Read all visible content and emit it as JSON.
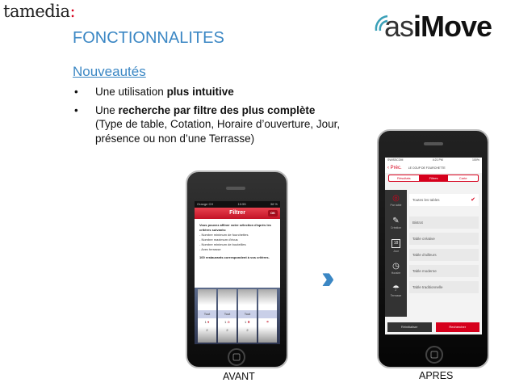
{
  "brand": {
    "tamedia": "tamedia",
    "colon": ":",
    "asimove_light": "as",
    "asimove_bold": "iMove"
  },
  "title": "FONCTIONNALITES",
  "subtitle": "Nouveautés",
  "bullets": [
    {
      "pre": "Une utilisation ",
      "bold": "plus intuitive",
      "post": ""
    },
    {
      "pre": "Une ",
      "bold": "recherche par filtre des plus complète",
      "post": " (Type de table, Cotation, Horaire d’ouverture, Jour, présence ou non d’une Terrasse)"
    }
  ],
  "before": {
    "caption": "AVANT",
    "status": {
      "carrier": "Orange CH",
      "time": "10:55",
      "battery": "38 %"
    },
    "header": "Filtrer",
    "ok": "OK",
    "intro": "Vous pouvez affiner votre sélection d'après les critères suivants:",
    "criteria": [
      "- Nombre minimum de fourchettes",
      "- Nombre maximum d'écus",
      "- Nombre minimum de bouteilles",
      "- Avec terrasse"
    ],
    "result": "100 restaurants correspondent à vos critères.",
    "drum": [
      {
        "head": "Tout",
        "r1": "1",
        "r2": "2"
      },
      {
        "head": "Tout",
        "r1": "1",
        "r2": "2"
      },
      {
        "head": "Tout",
        "r1": "1",
        "r2": "2"
      },
      {
        "head": "",
        "r1": "☂",
        "r2": ""
      }
    ]
  },
  "after": {
    "caption": "APRES",
    "status": {
      "carrier": "SWISSCOM",
      "time": "4:21 PM",
      "battery": "100%"
    },
    "back": "Préc.",
    "nav_title": "LE COUP DE FOURCHETTE",
    "tabs": [
      "Résultats",
      "Filtres",
      "Carte"
    ],
    "side": [
      "Par table",
      "Création",
      "Jour",
      "Horaire",
      "Terrasse"
    ],
    "side_day": "18",
    "options": [
      "Toutes les tables",
      "Bistrot",
      "Table créative",
      "Table d'ailleurs",
      "Table moderne",
      "Table traditionnelle"
    ],
    "reset": "Réinitialiser",
    "search": "Rechercher"
  },
  "colors": {
    "accent": "#3b87c4",
    "red": "#d6001c"
  }
}
